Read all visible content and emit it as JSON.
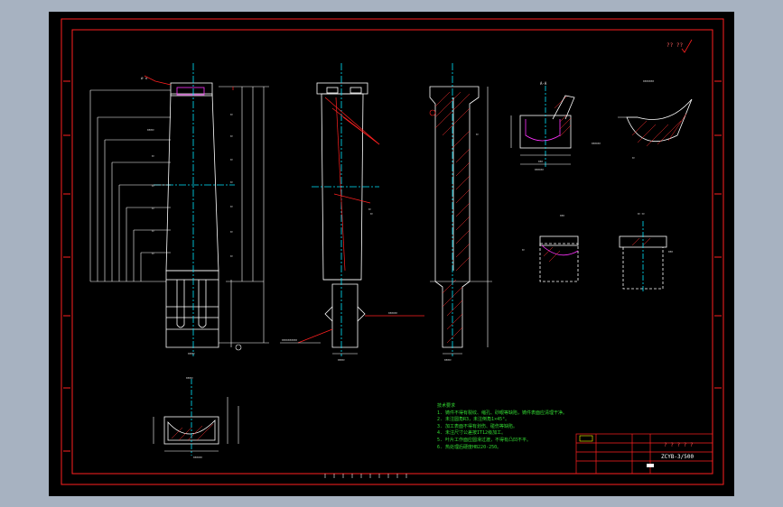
{
  "drawing": {
    "title_code": "ZCYB-3/500",
    "title_marks": "? ? ? ? ?",
    "corner_mark": "?? ??",
    "notes_heading": "技术要求",
    "notes": [
      "1. 铸件不得有裂纹、缩孔、砂眼等缺陷，铸件表面应清理干净。",
      "2. 未注圆角R3，未注倒角1×45°。",
      "3. 加工表面不得有划伤、碰伤等缺陷。",
      "4. 未注尺寸公差按IT12级加工。",
      "5. 叶片工作面应圆滑过渡，不得有凸凹不平。",
      "6. 热处理后硬度HB220-250。"
    ]
  },
  "colors": {
    "background": "#000000",
    "frame": "#ff2020",
    "dimension": "#ffffff",
    "centerline": "#00e5ff",
    "note_text": "#33dd33",
    "hatch": "#ff3030",
    "highlight": "#ff33ff"
  }
}
